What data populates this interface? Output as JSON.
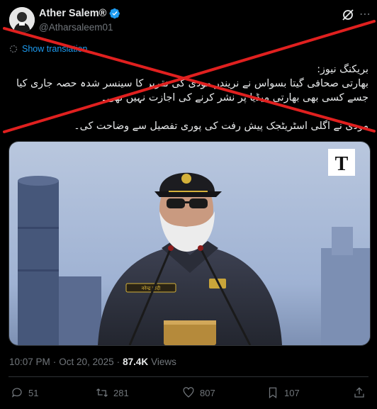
{
  "author": {
    "display_name": "Ather Salem®",
    "handle": "@Atharsaleem01"
  },
  "translate_label": "Show translation",
  "tweet": {
    "line1": "بریکنگ نیوز:",
    "line2": "بھارتی صحافی گیتا بسواس نے نریندر مودی کی تقریر کا سینسر شدہ حصہ جاری کیا",
    "line3": "جسے کسی بھی بھارتی میڈیا پر نشر کرنے کی اجازت نہیں تھی۔",
    "line4": "مودی نے اگلی اسٹریٹجک پیش رفت کی پوری تفصیل سے وضاحت کی۔"
  },
  "media": {
    "watermark": "T",
    "name_tag": "नरेन्द्र मोदी"
  },
  "meta": {
    "time": "10:07 PM",
    "separator": "·",
    "date": "Oct 20, 2025",
    "separator2": "·",
    "views_count": "87.4K",
    "views_label": "Views"
  },
  "actions": {
    "replies": "51",
    "reposts": "281",
    "likes": "807",
    "bookmarks": "107"
  },
  "colors": {
    "background": "#000000",
    "accent": "#1d9bf0",
    "strike": "#e0201f",
    "muted": "#71767b"
  },
  "icons": [
    "avatar",
    "verified-badge-icon",
    "grok-icon",
    "more-icon",
    "translate-icon",
    "reply-icon",
    "repost-icon",
    "like-icon",
    "bookmark-icon",
    "share-icon"
  ]
}
